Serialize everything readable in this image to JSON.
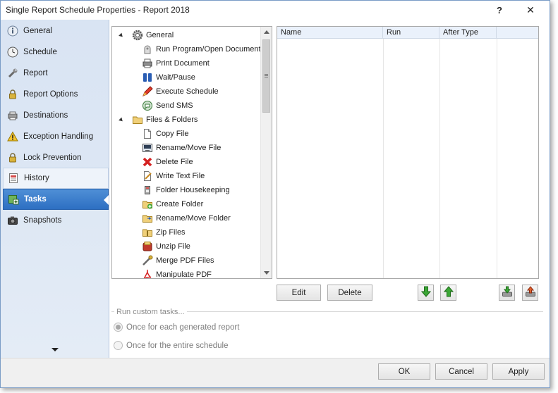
{
  "window": {
    "title": "Single Report Schedule Properties - Report 2018",
    "help_label": "?",
    "close_label": "✕"
  },
  "sidebar": {
    "items": [
      {
        "label": "General",
        "icon": "info-icon"
      },
      {
        "label": "Schedule",
        "icon": "clock-icon"
      },
      {
        "label": "Report",
        "icon": "wrench-icon"
      },
      {
        "label": "Report Options",
        "icon": "lock-icon"
      },
      {
        "label": "Destinations",
        "icon": "printer-icon"
      },
      {
        "label": "Exception Handling",
        "icon": "warning-icon"
      },
      {
        "label": "Lock Prevention",
        "icon": "lock-icon"
      },
      {
        "label": "History",
        "icon": "history-icon"
      },
      {
        "label": "Tasks",
        "icon": "tasks-icon"
      },
      {
        "label": "Snapshots",
        "icon": "camera-icon"
      }
    ],
    "active": "Tasks"
  },
  "tree": {
    "groups": [
      {
        "label": "General",
        "children": [
          "Run Program/Open Document",
          "Print Document",
          "Wait/Pause",
          "Execute Schedule",
          "Send SMS"
        ]
      },
      {
        "label": "Files & Folders",
        "children": [
          "Copy File",
          "Rename/Move File",
          "Delete File",
          "Write Text File",
          "Folder Housekeeping",
          "Create Folder",
          "Rename/Move Folder",
          "Zip Files",
          "Unzip File",
          "Merge PDF Files",
          "Manipulate PDF"
        ]
      }
    ]
  },
  "tasklist": {
    "columns": [
      "Name",
      "Run",
      "After Type"
    ]
  },
  "buttons": {
    "edit": "Edit",
    "delete": "Delete",
    "ok": "OK",
    "cancel": "Cancel",
    "apply": "Apply"
  },
  "custom_tasks": {
    "label": "Run custom tasks...",
    "options": [
      "Once for each generated report",
      "Once for the entire schedule"
    ],
    "selected": 0
  },
  "colors": {
    "accent": "#2d6fc2",
    "sidebar_bg": "#dde7f4",
    "arrow_green": "#3aa635"
  }
}
